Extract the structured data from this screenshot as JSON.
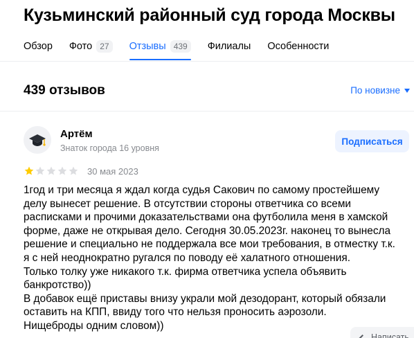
{
  "header": {
    "title": "Кузьминский районный суд города Москвы"
  },
  "tabs": [
    {
      "label": "Обзор",
      "count": ""
    },
    {
      "label": "Фото",
      "count": "27"
    },
    {
      "label": "Отзывы",
      "count": "439",
      "active": true
    },
    {
      "label": "Филиалы",
      "count": ""
    },
    {
      "label": "Особенности",
      "count": ""
    }
  ],
  "reviews_summary": {
    "count_label": "439 отзывов",
    "sort_label": "По новизне"
  },
  "review": {
    "author_name": "Артём",
    "author_level": "Знаток города 16 уровня",
    "subscribe_label": "Подписаться",
    "rating": 1,
    "rating_max": 5,
    "date": "30 мая 2023",
    "text": "1год и три месяца я ждал когда судья Сакович по самому простейшему\nделу вынесет решение. В отсутствии стороны ответчика со всеми\nрасписками и прочими доказательствами она футболила меня в хамской\nформе, даже не открывая дело. Сегодня 30.05.2023г. наконец то вынесла\nрешение и специально не поддержала все мои требования, в отместку т.к.\nя с ней неоднократно ругался по поводу её халатного отношения.\nТолько толку уже никакого т.к. фирма ответчика успела объявить\nбанкротство))\nВ добавок ещё приставы внизу украли мой дезодорант, который обязали\nоставить на КПП, ввиду того что нельзя проносить аэрозоли.\nНищеброды одним словом))"
  },
  "reply_button": {
    "label": "Написать"
  },
  "colors": {
    "accent": "#196dff",
    "star_filled": "#fc0",
    "star_empty": "#dcdde0",
    "muted_text": "#878a8f"
  }
}
